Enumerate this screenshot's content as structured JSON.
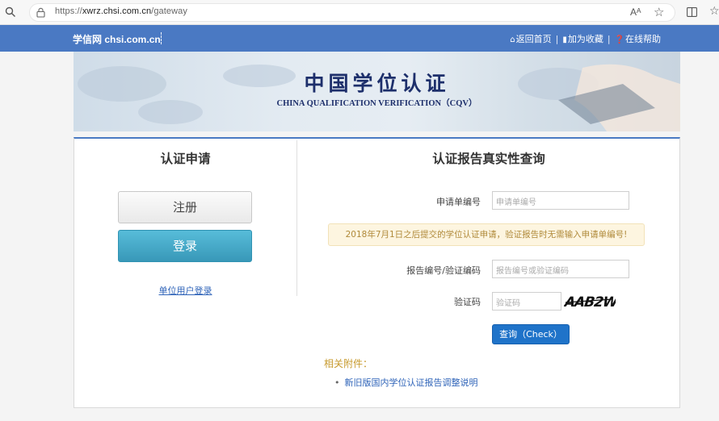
{
  "browser": {
    "url_prefix": "https://",
    "url_host": "xwrz.chsi.com.cn",
    "url_path": "/gateway",
    "read_aloud_label": "Aᴬ"
  },
  "site": {
    "brand": "学信网 chsi.com.cn",
    "nav": [
      {
        "label": "返回首页",
        "icon": "home-icon"
      },
      {
        "label": "加为收藏",
        "icon": "bookmark-icon"
      },
      {
        "label": "在线帮助",
        "icon": "help-icon"
      }
    ]
  },
  "banner": {
    "title": "中国学位认证",
    "subtitle": "CHINA QUALIFICATION VERIFICATION（CQV）"
  },
  "left": {
    "title": "认证申请",
    "register_label": "注册",
    "login_label": "登录",
    "unit_login_label": "单位用户登录"
  },
  "right": {
    "title": "认证报告真实性查询",
    "app_no_label": "申请单编号",
    "app_no_placeholder": "申请单编号",
    "notice": "2018年7月1日之后提交的学位认证申请，验证报告时无需输入申请单编号!",
    "report_no_label": "报告编号/验证编码",
    "report_no_placeholder": "报告编号或验证编码",
    "captcha_label": "验证码",
    "captcha_placeholder": "验证码",
    "captcha_text": "AAB2W",
    "query_label": "查询（Check）",
    "attachments_title": "相关附件：",
    "attachments": [
      "新旧版国内学位认证报告调整说明"
    ]
  },
  "colors": {
    "header_blue": "#4a79c3",
    "login_teal": "#3fa6c6",
    "query_blue": "#1f73c9",
    "notice_bg": "#fdf5e0",
    "link_blue": "#2e63b8"
  }
}
